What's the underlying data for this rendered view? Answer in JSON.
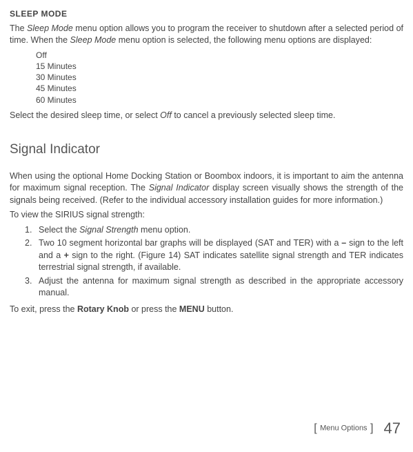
{
  "sleep_mode": {
    "header": "SLEEP MODE",
    "intro_part1": "The ",
    "intro_em1": "Sleep Mode",
    "intro_part2": " menu option allows you to program the receiver to shutdown after a selected period of time. When the ",
    "intro_em2": "Sleep Mode",
    "intro_part3": " menu option is selected, the following menu options are displayed:",
    "options": {
      "o1": "Off",
      "o2": "15 Minutes",
      "o3": "30 Minutes",
      "o4": "45 Minutes",
      "o5": "60 Minutes"
    },
    "closing_part1": "Select the desired sleep time, or select ",
    "closing_em": "Off",
    "closing_part2": " to cancel a previously selected sleep time."
  },
  "signal_indicator": {
    "title": "Signal Indicator",
    "para1_part1": "When using the optional Home Docking Station or Boombox indoors, it is important to aim the antenna for maximum signal reception. The ",
    "para1_em": "Signal Indicator",
    "para1_part2": " display screen visually shows the strength of the signals being received. (Refer to the individual accessory installation guides for more information.)",
    "para2": "To view the SIRIUS signal strength:",
    "steps": {
      "s1_num": "1.",
      "s1_part1": "Select the ",
      "s1_em": "Signal Strength",
      "s1_part2": " menu option.",
      "s2_num": "2.",
      "s2_part1": "Two 10 segment horizontal bar graphs will be displayed (SAT and TER) with a ",
      "s2_bold1": "–",
      "s2_part2": " sign to the left and a ",
      "s2_bold2": "+",
      "s2_part3": " sign to the right. (Figure 14) SAT indicates satellite signal strength and TER indicates terrestrial signal strength, if available.",
      "s3_num": "3.",
      "s3_text": "Adjust the antenna for maximum signal strength as described in the appropriate accessory manual."
    },
    "exit_part1": "To exit, press the ",
    "exit_bold1": "Rotary Knob",
    "exit_part2": " or press the ",
    "exit_bold2": "MENU",
    "exit_part3": " button."
  },
  "footer": {
    "label": "Menu Options",
    "page": "47"
  }
}
